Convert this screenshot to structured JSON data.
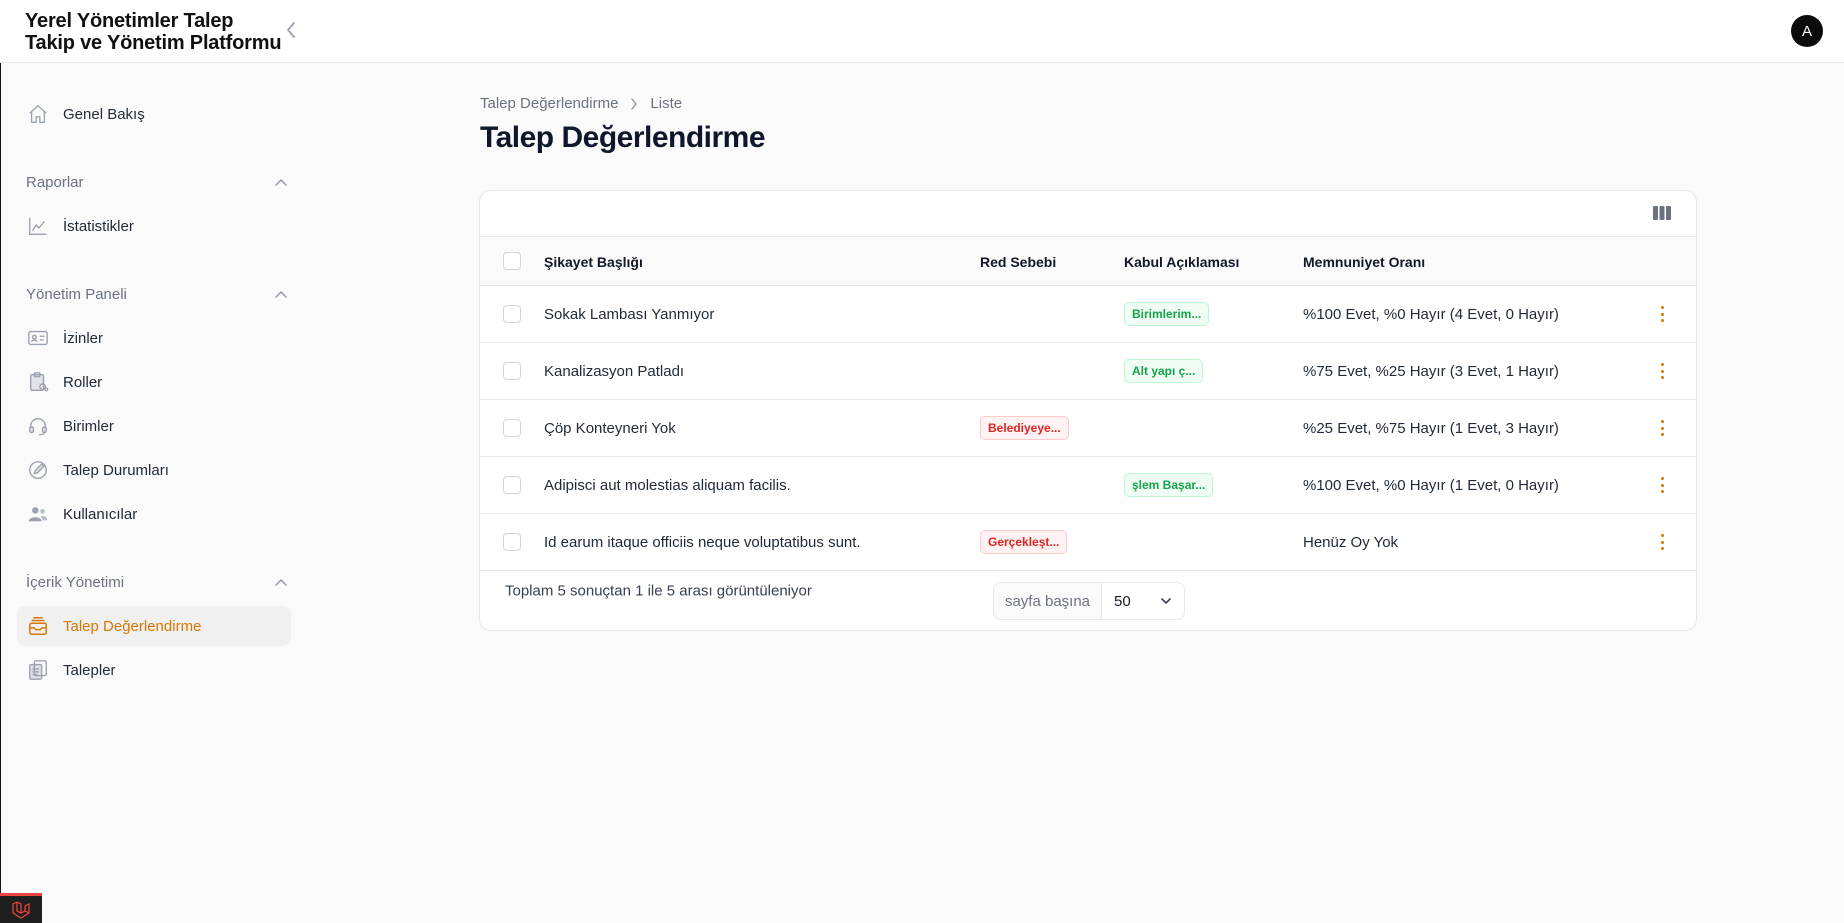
{
  "app": {
    "title_line1": "Yerel Yönetimler Talep",
    "title_line2": "Takip ve Yönetim Platformu",
    "avatar_letter": "A"
  },
  "sidebar": {
    "top": {
      "label": "Genel Bakış",
      "icon": "home-icon"
    },
    "groups": [
      {
        "label": "Raporlar",
        "items": [
          {
            "label": "İstatistikler",
            "icon": "chart-line-icon"
          }
        ]
      },
      {
        "label": "Yönetim Paneli",
        "items": [
          {
            "label": "İzinler",
            "icon": "id-card-icon"
          },
          {
            "label": "Roller",
            "icon": "clipboard-link-icon"
          },
          {
            "label": "Birimler",
            "icon": "headset-icon"
          },
          {
            "label": "Talep Durumları",
            "icon": "pencil-circle-icon"
          },
          {
            "label": "Kullanıcılar",
            "icon": "users-icon"
          }
        ]
      },
      {
        "label": "İçerik Yönetimi",
        "items": [
          {
            "label": "Talep Değerlendirme",
            "icon": "inbox-stack-icon",
            "active": true
          },
          {
            "label": "Talepler",
            "icon": "document-duplicate-icon"
          }
        ]
      }
    ]
  },
  "breadcrumb": {
    "parent": "Talep Değerlendirme",
    "current": "Liste"
  },
  "page_title": "Talep Değerlendirme",
  "table": {
    "columns": [
      "Şikayet Başlığı",
      "Red Sebebi",
      "Kabul Açıklaması",
      "Memnuniyet Oranı"
    ],
    "rows": [
      {
        "title": "Sokak Lambası Yanmıyor",
        "red": "",
        "kabul": "Birimlerim...",
        "memnuniyet": "%100 Evet, %0 Hayır (4 Evet, 0 Hayır)"
      },
      {
        "title": "Kanalizasyon Patladı",
        "red": "",
        "kabul": "Alt yapı ç...",
        "memnuniyet": "%75 Evet, %25 Hayır (3 Evet, 1 Hayır)"
      },
      {
        "title": "Çöp Konteyneri Yok",
        "red": "Belediyeye...",
        "kabul": "",
        "memnuniyet": "%25 Evet, %75 Hayır (1 Evet, 3 Hayır)"
      },
      {
        "title": "Adipisci aut molestias aliquam facilis.",
        "red": "",
        "kabul": "şlem Başar...",
        "memnuniyet": "%100 Evet, %0 Hayır (1 Evet, 0 Hayır)"
      },
      {
        "title": "Id earum itaque officiis neque voluptatibus sunt.",
        "red": "Gerçekleşt...",
        "kabul": "",
        "memnuniyet": "Henüz Oy Yok"
      }
    ],
    "footer_info": "Toplam 5 sonuçtan 1 ile 5 arası görüntüleniyor",
    "per_page_label": "sayfa başına",
    "per_page_value": "50"
  },
  "colors": {
    "accent": "#d97706",
    "green": "#16a34a",
    "red": "#dc2626"
  }
}
